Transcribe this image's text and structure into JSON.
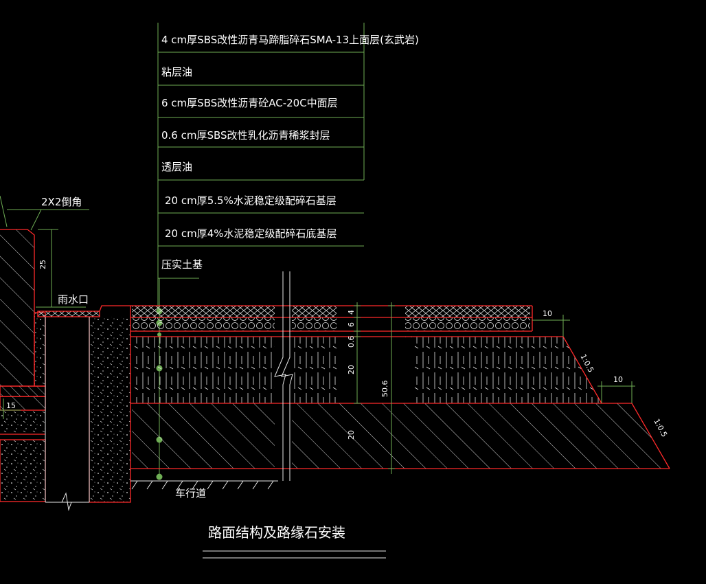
{
  "layers": [
    "4 cm厚SBS改性沥青马蹄脂碎石SMA-13上面层(玄武岩)",
    "粘层油",
    "6 cm厚SBS改性沥青砼AC-20C中面层",
    "0.6 cm厚SBS改性乳化沥青稀浆封层",
    "透层油",
    "20 cm厚5.5%水泥稳定级配碎石基层",
    "20 cm厚4%水泥稳定级配碎石底基层",
    "压实土基"
  ],
  "annotations": {
    "chamfer": "2X2倒角",
    "inlet": "雨水口",
    "lane": "车行道",
    "title": "路面结构及路缘石安装"
  },
  "dimensions": {
    "d25": "25",
    "d15": "15",
    "d4": "4",
    "d6": "6",
    "d06": "0.6",
    "d20a": "20",
    "d20b": "20",
    "d506": "50.6",
    "d10a": "10",
    "d10b": "10",
    "slope1": "1:0.5",
    "slope2": "1:0.5"
  },
  "colors": {
    "structure": "#ff2a2a",
    "annotation": "#6fae55",
    "text": "#ffffff",
    "background": "#000000"
  }
}
